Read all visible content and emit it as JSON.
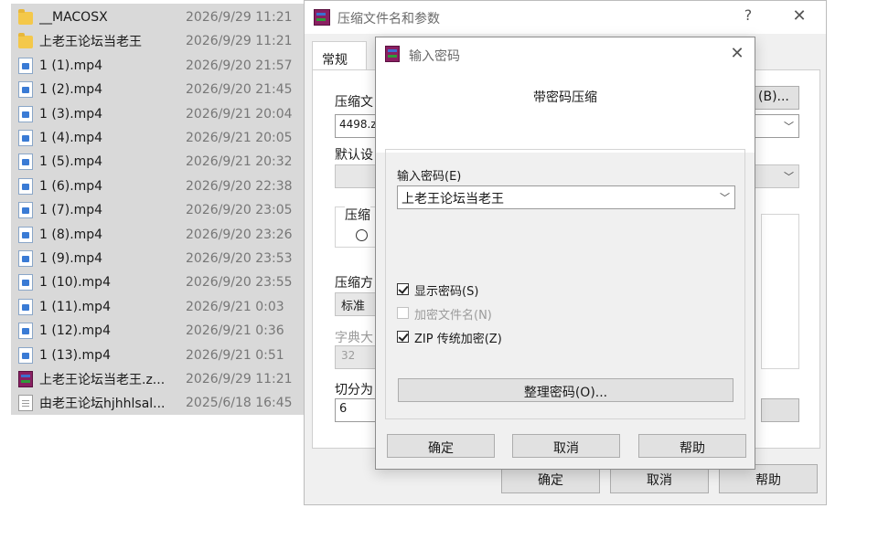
{
  "file_list": [
    {
      "name": "__MACOSX",
      "date": "2026/9/29 11:21",
      "icon": "folder-icon"
    },
    {
      "name": "上老王论坛当老王",
      "date": "2026/9/29 11:21",
      "icon": "folder-icon"
    },
    {
      "name": "1 (1).mp4",
      "date": "2026/9/20 21:57",
      "icon": "mp4-file-icon"
    },
    {
      "name": "1 (2).mp4",
      "date": "2026/9/20 21:45",
      "icon": "mp4-file-icon"
    },
    {
      "name": "1 (3).mp4",
      "date": "2026/9/21 20:04",
      "icon": "mp4-file-icon"
    },
    {
      "name": "1 (4).mp4",
      "date": "2026/9/21 20:05",
      "icon": "mp4-file-icon"
    },
    {
      "name": "1 (5).mp4",
      "date": "2026/9/21 20:32",
      "icon": "mp4-file-icon"
    },
    {
      "name": "1 (6).mp4",
      "date": "2026/9/20 22:38",
      "icon": "mp4-file-icon"
    },
    {
      "name": "1 (7).mp4",
      "date": "2026/9/20 23:05",
      "icon": "mp4-file-icon"
    },
    {
      "name": "1 (8).mp4",
      "date": "2026/9/20 23:26",
      "icon": "mp4-file-icon"
    },
    {
      "name": "1 (9).mp4",
      "date": "2026/9/20 23:53",
      "icon": "mp4-file-icon"
    },
    {
      "name": "1 (10).mp4",
      "date": "2026/9/20 23:55",
      "icon": "mp4-file-icon"
    },
    {
      "name": "1 (11).mp4",
      "date": "2026/9/21 0:03",
      "icon": "mp4-file-icon"
    },
    {
      "name": "1 (12).mp4",
      "date": "2026/9/21 0:36",
      "icon": "mp4-file-icon"
    },
    {
      "name": "1 (13).mp4",
      "date": "2026/9/21 0:51",
      "icon": "mp4-file-icon"
    },
    {
      "name": "上老王论坛当老王.z...",
      "date": "2026/9/29 11:21",
      "icon": "winrar-archive-icon"
    },
    {
      "name": "由老王论坛hjhhlsal...",
      "date": "2025/6/18 16:45",
      "icon": "text-file-icon"
    }
  ],
  "archive_dialog": {
    "title": "压缩文件名和参数",
    "help_glyph": "?",
    "close_glyph": "✕",
    "tab_general": "常规",
    "archive_name_label": "压缩文",
    "archive_name_value": "4498.z",
    "browse_label": "(B)...",
    "default_profile_label": "默认设",
    "format_label": "压缩",
    "method_label": "压缩方",
    "method_value": "标准",
    "dict_label": "字典大",
    "dict_value": "32",
    "split_label": "切分为",
    "split_value": "6",
    "ok": "确定",
    "cancel": "取消",
    "help": "帮助"
  },
  "password_dialog": {
    "title": "输入密码",
    "close_glyph": "✕",
    "heading": "带密码压缩",
    "password_label": "输入密码(E)",
    "password_value": "上老王论坛当老王",
    "show_password": {
      "label": "显示密码(S)",
      "checked": true,
      "enabled": true
    },
    "encrypt_names": {
      "label": "加密文件名(N)",
      "checked": false,
      "enabled": false
    },
    "zip_legacy": {
      "label": "ZIP 传统加密(Z)",
      "checked": true,
      "enabled": true
    },
    "organize_button": "整理密码(O)...",
    "ok": "确定",
    "cancel": "取消",
    "help": "帮助"
  }
}
